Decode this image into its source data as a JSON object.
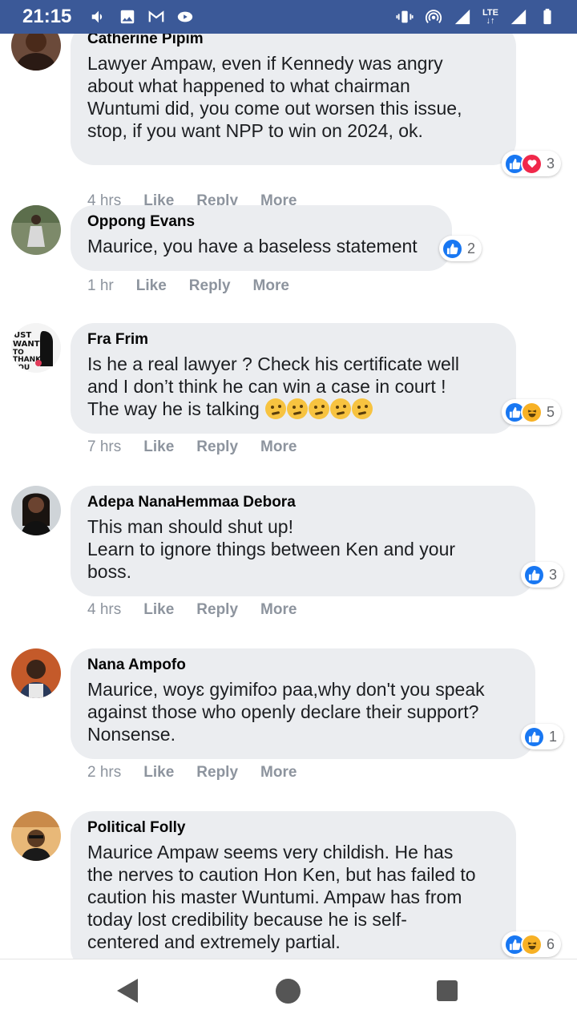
{
  "status_bar": {
    "time": "21:15",
    "network": "LTE",
    "left_icons": [
      "volume-icon",
      "image-icon",
      "gmail-icon",
      "media-icon"
    ],
    "right_icons": [
      "vibrate-icon",
      "hotspot-icon",
      "signal-icon",
      "lte-icon",
      "battery-icon"
    ]
  },
  "actions": {
    "like": "Like",
    "reply": "Reply",
    "more": "More"
  },
  "comments": [
    {
      "author": "Catherine Pipim",
      "text": "Lawyer Ampaw, even if Kennedy was angry\nabout what happened to what chairman\nWuntumi did, you come out worsen this issue,\nstop, if you want NPP to win on 2024, ok.",
      "time": "4 hrs",
      "reactions": [
        "like",
        "love"
      ],
      "reaction_count": "3"
    },
    {
      "author": "Oppong Evans",
      "text": "Maurice, you have a baseless statement",
      "time": "1 hr",
      "reactions": [
        "like"
      ],
      "reaction_count": "2"
    },
    {
      "author": "Fra Frim",
      "text": "Is he a real lawyer ? Check his certificate well\nand I don’t think he can win a case in court !\nThe way he is talking ",
      "emoji_count": 5,
      "time": "7 hrs",
      "reactions": [
        "like",
        "haha"
      ],
      "reaction_count": "5"
    },
    {
      "author": "Adepa NanaHemmaa Debora",
      "text": "This man should shut up!\nLearn to ignore things between Ken and your\nboss.",
      "time": "4 hrs",
      "reactions": [
        "like"
      ],
      "reaction_count": "3"
    },
    {
      "author": "Nana Ampofo",
      "text": "Maurice, woyɛ gyimifoɔ paa,why don't you speak\nagainst those who openly declare their support?\nNonsense.",
      "time": "2 hrs",
      "reactions": [
        "like"
      ],
      "reaction_count": "1"
    },
    {
      "author": "Political Folly",
      "text": "Maurice Ampaw seems very childish. He has\nthe nerves to caution Hon Ken, but has failed to\ncaution his master Wuntumi. Ampaw has from\ntoday lost credibility because he is self-\ncentered and extremely partial.",
      "time": "",
      "reactions": [
        "like",
        "haha"
      ],
      "reaction_count": "6"
    }
  ],
  "colors": {
    "status_bar": "#3b5998",
    "bubble": "#ebedf0",
    "like": "#1877f2",
    "love": "#f0284a",
    "meta_text": "#8d949e"
  },
  "nav": {
    "icons": [
      "back-icon",
      "home-icon",
      "recents-icon"
    ]
  }
}
